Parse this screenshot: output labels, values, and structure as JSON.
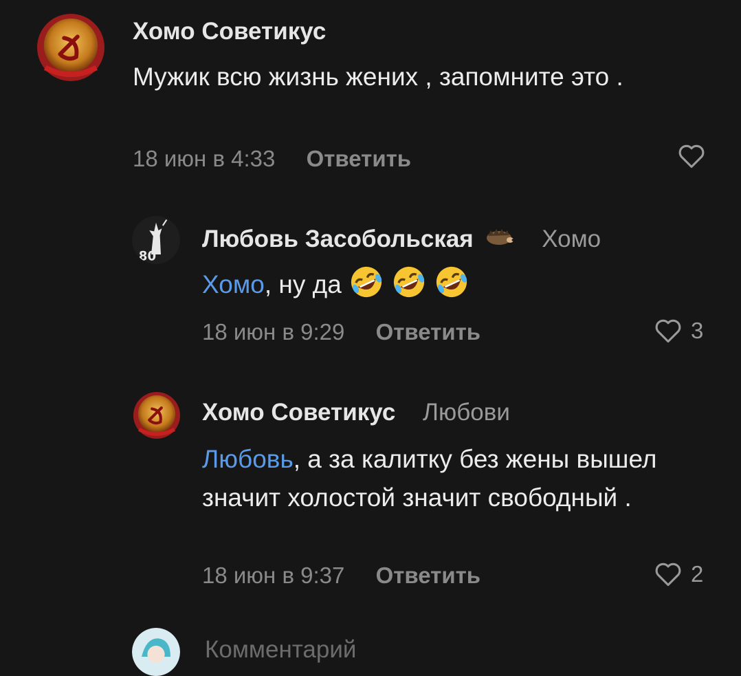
{
  "comments": [
    {
      "author": "Хомо Советикус",
      "reply_to": "",
      "mention": "",
      "text": "Мужик всю жизнь жених , запомните это .",
      "date": "18 июн в 4:33",
      "reply_label": "Ответить",
      "likes": "",
      "avatar_icon": "soviet-emblem-icon"
    },
    {
      "author": "Любовь Засобольская",
      "reply_to": "Хомо",
      "mention": "Хомо",
      "text": ", ну да",
      "emoji": [
        "rolling-on-floor-laughing-emoji",
        "rolling-on-floor-laughing-emoji",
        "rolling-on-floor-laughing-emoji"
      ],
      "date": "18 июн в 9:29",
      "reply_label": "Ответить",
      "likes": "3",
      "avatar_icon": "motherland-statue-80-icon",
      "avatar_badge": "80"
    },
    {
      "author": "Хомо Советикус",
      "reply_to": "Любови",
      "mention": "Любовь",
      "text": ", а за калитку без жены вышел значит холостой значит свободный .",
      "date": "18 июн в 9:37",
      "reply_label": "Ответить",
      "likes": "2",
      "avatar_icon": "soviet-emblem-icon"
    }
  ],
  "comment_input": {
    "placeholder": "Комментарий",
    "avatar_icon": "user-avatar-icon"
  },
  "colors": {
    "background": "#161616",
    "mention": "#5b9ae6",
    "meta": "#8a8a8a"
  }
}
